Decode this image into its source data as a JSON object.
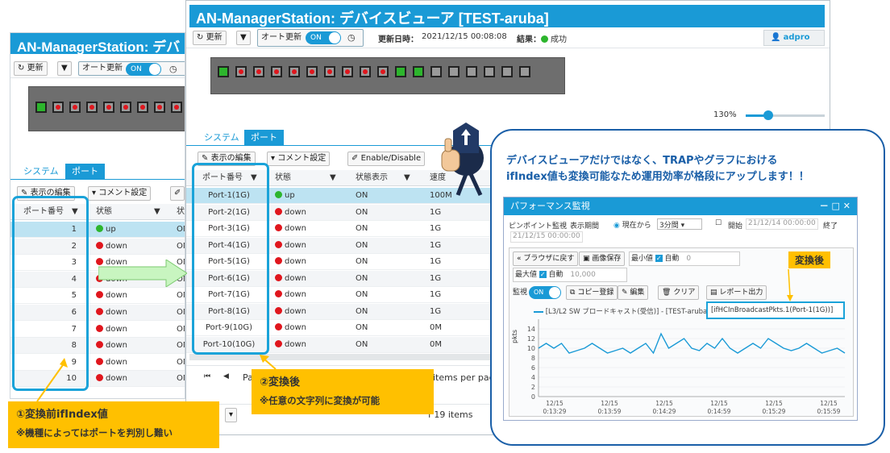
{
  "app_title": "AN-ManagerStation: デバイスビューア [TEST-aruba]",
  "back_title": "AN-ManagerStation: デバ",
  "toolbar": {
    "refresh": "更新",
    "dropdown": "▼",
    "auto_update": "オート更新",
    "toggle_on": "ON",
    "clock": "◷",
    "updated_label": "更新日時：",
    "updated_value": "2021/12/15 00:08:08",
    "result_label": "結果：",
    "result_value": "成功",
    "user": "adpro"
  },
  "zoom": "130%",
  "tabs": {
    "system": "システム",
    "port": "ポート"
  },
  "grid_toolbar": {
    "display_edit": "表示の編集",
    "comment_settings": "コメント設定",
    "enable_disable": "Enable/Disable"
  },
  "columns": {
    "port_no": "ポート番号",
    "state": "状態",
    "state_display": "状態表示",
    "speed": "速度",
    "short_c": "状"
  },
  "rows_before": [
    {
      "idx": "1",
      "state": "up",
      "c": "ON"
    },
    {
      "idx": "2",
      "state": "down",
      "c": "ON"
    },
    {
      "idx": "3",
      "state": "down",
      "c": "ON"
    },
    {
      "idx": "4",
      "state": "down",
      "c": "ON"
    },
    {
      "idx": "5",
      "state": "down",
      "c": "ON"
    },
    {
      "idx": "6",
      "state": "down",
      "c": "ON"
    },
    {
      "idx": "7",
      "state": "down",
      "c": "ON"
    },
    {
      "idx": "8",
      "state": "down",
      "c": "ON"
    },
    {
      "idx": "9",
      "state": "down",
      "c": "ON"
    },
    {
      "idx": "10",
      "state": "down",
      "c": "ON"
    }
  ],
  "rows_after": [
    {
      "name": "Port-1(1G)",
      "state": "up",
      "disp": "ON",
      "speed": "100M"
    },
    {
      "name": "Port-2(1G)",
      "state": "down",
      "disp": "ON",
      "speed": "1G"
    },
    {
      "name": "Port-3(1G)",
      "state": "down",
      "disp": "ON",
      "speed": "1G"
    },
    {
      "name": "Port-4(1G)",
      "state": "down",
      "disp": "ON",
      "speed": "1G"
    },
    {
      "name": "Port-5(1G)",
      "state": "down",
      "disp": "ON",
      "speed": "1G"
    },
    {
      "name": "Port-6(1G)",
      "state": "down",
      "disp": "ON",
      "speed": "1G"
    },
    {
      "name": "Port-7(1G)",
      "state": "down",
      "disp": "ON",
      "speed": "1G"
    },
    {
      "name": "Port-8(1G)",
      "state": "down",
      "disp": "ON",
      "speed": "1G"
    },
    {
      "name": "Port-9(10G)",
      "state": "down",
      "disp": "ON",
      "speed": "0M"
    },
    {
      "name": "Port-10(10G)",
      "state": "down",
      "disp": "ON",
      "speed": "0M"
    }
  ],
  "pager": {
    "first": "⏮",
    "prev": "◀",
    "page_short": "Pa",
    "items_per_page": "items per page",
    "items_count": "f 19 items"
  },
  "callouts": {
    "before_line1": "①変換前ifIndex値",
    "before_line2": "※機種によってはポートを判別し難い",
    "after_line1": "②変換後",
    "after_line2": "※任意の文字列に変換が可能"
  },
  "bubble": {
    "line1": "デバイスビューアだけではなく、TRAPやグラフにおける",
    "line2": "ifIndex値も変換可能なため運用効率が格段にアップします！！"
  },
  "perf": {
    "title": "パフォーマンス監視",
    "win_controls": "－ □ ✕",
    "pinpoint": "ピンポイント監視",
    "period": "表示期間",
    "from_now": "現在から",
    "span": "3分間",
    "start": "開始",
    "start_val": "21/12/14 00:00:00",
    "end": "終了",
    "end_val": "21/12/15 00:00:00",
    "back_browser": "ブラウザに戻す",
    "save_image": "画像保存",
    "min_label": "最小値",
    "auto": "自動",
    "min_val": "0",
    "max_label": "最大値",
    "max_val": "10,000",
    "monitor": "監視",
    "copy": "コピー登録",
    "edit": "編集",
    "clear": "クリア",
    "report": "レポート出力",
    "converted": "変換後",
    "legend_prefix": "[L3/L2 SW ブロードキャスト(受信)] - [TEST-aruba] -",
    "legend_suffix": "[ifHCInBroadcastPkts.1(Port-1(1G))]",
    "ylabel": "pkts"
  },
  "chart_data": {
    "type": "line",
    "ylabel": "pkts",
    "ylim": [
      0,
      16
    ],
    "yticks": [
      0,
      2,
      4,
      6,
      8,
      10,
      12,
      14
    ],
    "xticks": [
      "12/15 0:13:29",
      "12/15 0:13:59",
      "12/15 0:14:29",
      "12/15 0:14:59",
      "12/15 0:15:29",
      "12/15 0:15:59"
    ],
    "series": [
      {
        "name": "[L3/L2 SW ブロードキャスト(受信)] - [TEST-aruba] - [ifHCInBroadcastPkts.1(Port-1(1G))]",
        "color": "#1a9ad6",
        "values": [
          10,
          11,
          10,
          11,
          9,
          9.5,
          10,
          11,
          10,
          9,
          9.5,
          10,
          9,
          10,
          11,
          9,
          13,
          10,
          11,
          12,
          10,
          9.5,
          11,
          10,
          12,
          10,
          9,
          10,
          11,
          10,
          12,
          11,
          10,
          9.5,
          10,
          11,
          10,
          9,
          9.5,
          10,
          9
        ]
      }
    ]
  },
  "colors": {
    "accent": "#1a9ad6",
    "up": "#2db52d",
    "down": "#e0161d",
    "callout": "#ffc000",
    "blue_box": "#1aa3d9"
  }
}
